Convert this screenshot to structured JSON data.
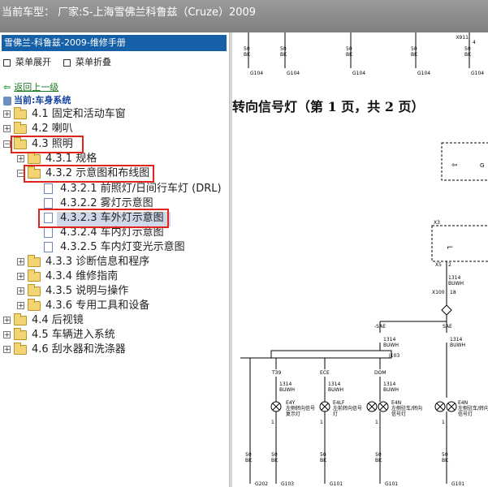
{
  "titlebar": {
    "text": "当前车型： 厂家:S-上海雪佛兰科鲁兹（Cruze）2009"
  },
  "left_pane": {
    "header": "雪佛兰-科鲁兹-2009-维修手册",
    "expand_menu": "菜单展开",
    "collapse_menu": "菜单折叠",
    "back_link": "返回上一级",
    "current_system": "当前:车身系统",
    "tree": [
      "4.1 固定和活动车窗",
      "4.2 喇叭",
      "4.3 照明",
      "4.3.1 规格",
      "4.3.2 示意图和布线图",
      "4.3.2.1 前照灯/日间行车灯 (DRL)",
      "4.3.2.2 雾灯示意图",
      "4.3.2.3 车外灯示意图",
      "4.3.2.4 车内灯示意图",
      "4.3.2.5 车内灯变光示意图",
      "4.3.3 诊断信息和程序",
      "4.3.4 维修指南",
      "4.3.5 说明与操作",
      "4.3.6 专用工具和设备",
      "4.4 后视镜",
      "4.5 车辆进入系统",
      "4.6 刮水器和洗涤器"
    ]
  },
  "diagram": {
    "title": "转向信号灯（第 1 页，共 2 页）",
    "top_labels": {
      "x911": "X911",
      "n4": "4",
      "wire": "50",
      "color": "BK",
      "grounds": [
        "G104",
        "G104",
        "G104",
        "G104",
        "G104"
      ]
    },
    "labels": {
      "x3": "X3",
      "x5": "X5",
      "two": "2",
      "wire_1314": "1314",
      "buwh": "BUWH",
      "x100": "X100",
      "eighteen": "18",
      "sae": "-SAE",
      "sae2": "SAE",
      "j103": "J103",
      "t39": "T39",
      "ece": "ECE",
      "dom": "DOM",
      "e4y": "E4Y",
      "e4y_desc1": "左侧转向信号",
      "e4y_desc2": "复示灯",
      "e4lf": "E4LF",
      "e4lf_desc1": "左前转向信号",
      "e4lf_desc2": "灯",
      "e4n": "E4N",
      "e4n_desc1": "左侧驻车/转向",
      "e4n_desc2": "信号灯",
      "e4n2": "E4N",
      "e4n2_desc1": "左侧驻车/转向",
      "e4n2_desc2": "信号灯",
      "one": "1",
      "g202": "G202",
      "g103": "G103",
      "g101": "G101",
      "right_g": "G",
      "right_g101": "G101"
    }
  },
  "colors": {
    "titlebar": "#8c8c8c",
    "header_bg": "#1660a8",
    "highlight_box": "#e0231b",
    "selected_bg": "#cfd7e8",
    "back_link": "#1a7a20"
  }
}
